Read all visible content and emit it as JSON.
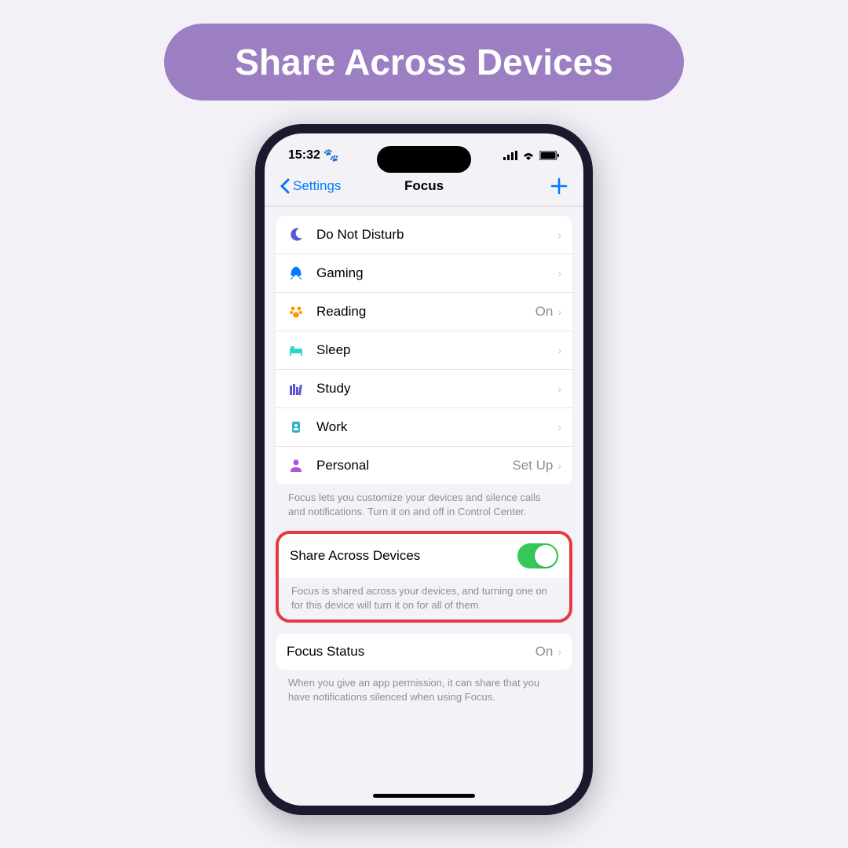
{
  "banner": {
    "title": "Share Across Devices"
  },
  "statusBar": {
    "time": "15:32"
  },
  "nav": {
    "back": "Settings",
    "title": "Focus"
  },
  "focusModes": [
    {
      "label": "Do Not Disturb",
      "value": ""
    },
    {
      "label": "Gaming",
      "value": ""
    },
    {
      "label": "Reading",
      "value": "On"
    },
    {
      "label": "Sleep",
      "value": ""
    },
    {
      "label": "Study",
      "value": ""
    },
    {
      "label": "Work",
      "value": ""
    },
    {
      "label": "Personal",
      "value": "Set Up"
    }
  ],
  "focusFooter": "Focus lets you customize your devices and silence calls and notifications. Turn it on and off in Control Center.",
  "share": {
    "label": "Share Across Devices",
    "footer": "Focus is shared across your devices, and turning one on for this device will turn it on for all of them."
  },
  "focusStatus": {
    "label": "Focus Status",
    "value": "On",
    "footer": "When you give an app permission, it can share that you have notifications silenced when using Focus."
  }
}
